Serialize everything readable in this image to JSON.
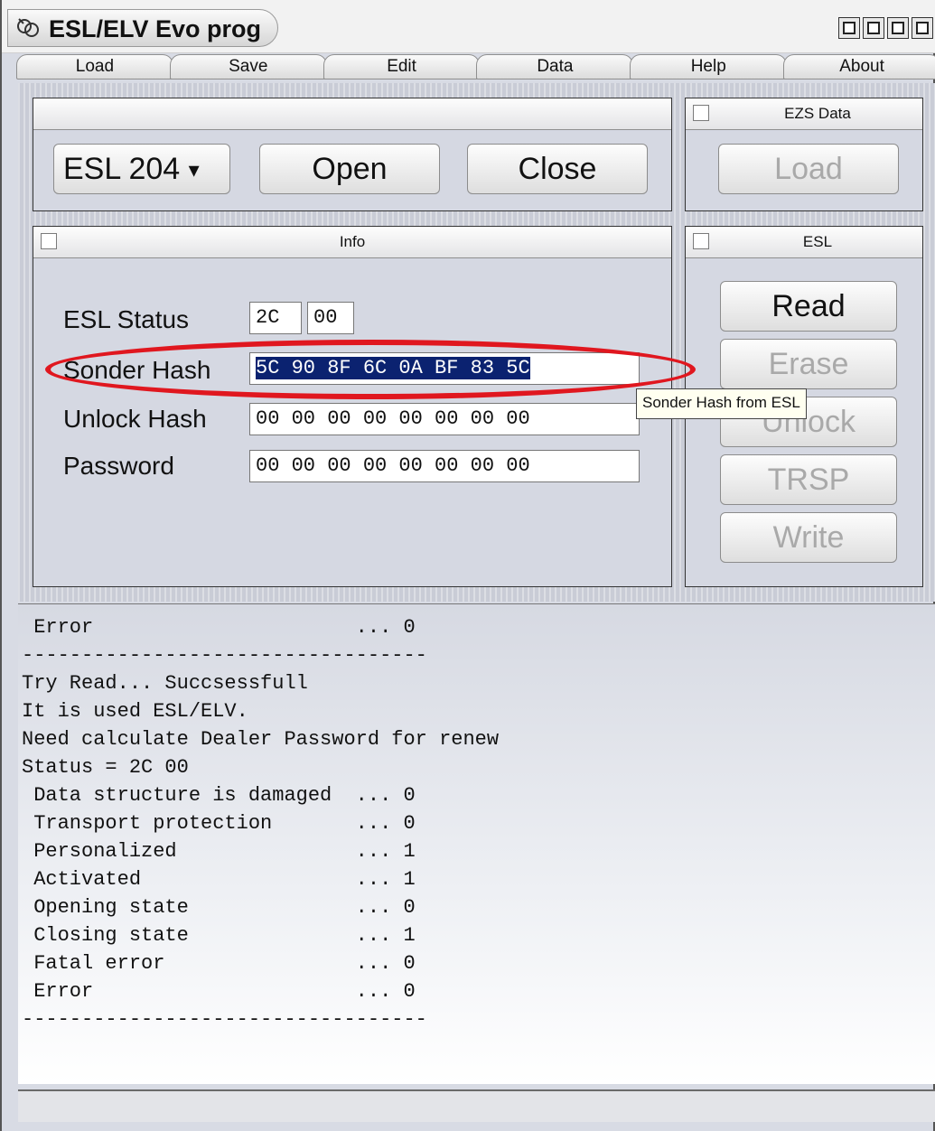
{
  "window": {
    "title": "ESL/ELV Evo prog"
  },
  "menu": [
    "Load",
    "Save",
    "Edit",
    "Data",
    "Help",
    "About"
  ],
  "top_panel": {
    "model_select": "ESL 204",
    "open_label": "Open",
    "close_label": "Close"
  },
  "ezs_panel": {
    "title": "EZS Data",
    "load_label": "Load"
  },
  "info_panel": {
    "title": "Info",
    "esl_status_label": "ESL Status",
    "esl_status_1": "2C",
    "esl_status_2": "00",
    "sonder_hash_label": "Sonder Hash",
    "sonder_hash_value": "5C 90 8F 6C 0A BF 83 5C",
    "unlock_hash_label": "Unlock Hash",
    "unlock_hash_value": "00 00 00 00 00 00 00 00",
    "password_label": "Password",
    "password_value": "00 00 00 00 00 00 00 00"
  },
  "tooltip": "Sonder Hash from ESL",
  "esl_panel": {
    "title": "ESL",
    "read_label": "Read",
    "erase_label": "Erase",
    "unlock_label": "Unlock",
    "trsp_label": "TRSP",
    "write_label": "Write"
  },
  "log": {
    "lines": [
      " Error                      ... 0",
      "----------------------------------",
      "Try Read... Succsessfull",
      "It is used ESL/ELV.",
      "Need calculate Dealer Password for renew",
      "Status = 2C 00",
      " Data structure is damaged  ... 0",
      " Transport protection       ... 0",
      " Personalized               ... 1",
      " Activated                  ... 1",
      " Opening state              ... 0",
      " Closing state              ... 1",
      " Fatal error                ... 0",
      " Error                      ... 0",
      "----------------------------------"
    ]
  },
  "colors": {
    "highlight_ring": "#e0171f",
    "selection": "#0b2270"
  }
}
